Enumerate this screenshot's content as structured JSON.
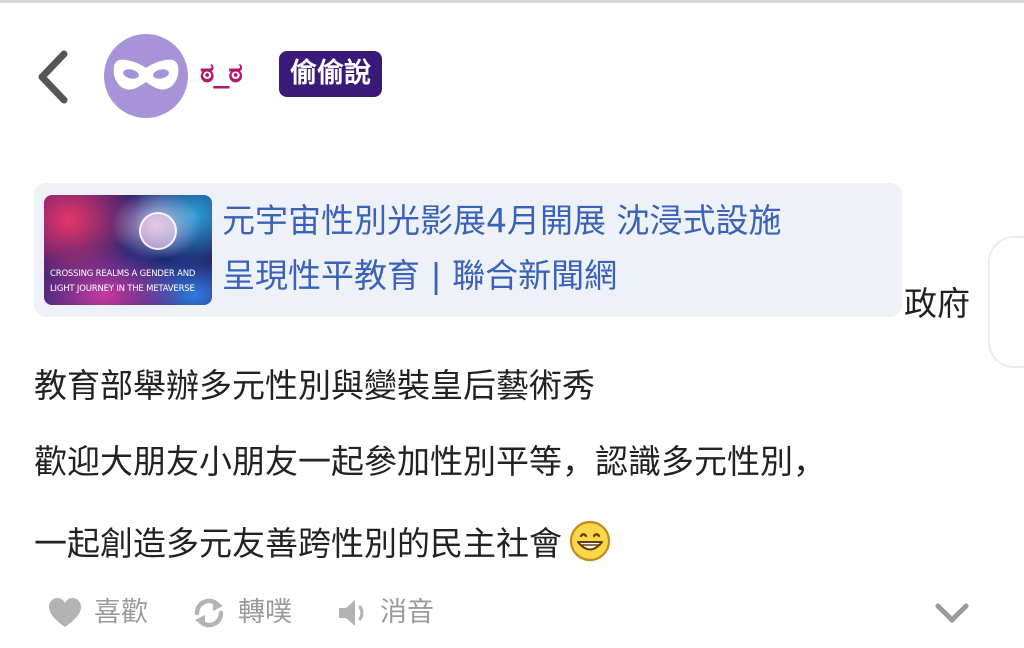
{
  "header": {
    "username": "ಠ_ಠ",
    "tag": "偷偷說"
  },
  "link_card": {
    "title_line1": "元宇宙性別光影展4月開展 沈浸式設施",
    "title_line2": "呈現性平教育 | 聯合新聞網",
    "thumbnail_text_line1": "CROSSING REALMS A GENDER AND",
    "thumbnail_text_line2": "LIGHT JOURNEY IN THE METAVERSE"
  },
  "post": {
    "trailing_text": "政府",
    "lines": [
      "教育部舉辦多元性別與變裝皇后藝術秀",
      "歡迎大朋友小朋友一起參加性別平等，認識多元性別，",
      "一起創造多元友善跨性別的民主社會"
    ],
    "emoji": "grinning-face"
  },
  "actions": {
    "like_label": "喜歡",
    "repost_label": "轉噗",
    "mute_label": "消音",
    "like_icon": "heart-icon",
    "repost_icon": "repost-icon",
    "mute_icon": "speaker-icon",
    "expand_icon": "chevron-down-icon"
  },
  "colors": {
    "avatar": "#a892d8",
    "username": "#b2166f",
    "tag_bg": "#3a1a78",
    "link": "#3a62b8",
    "link_card_bg": "#eef1f8",
    "action": "#9b9b9b"
  }
}
